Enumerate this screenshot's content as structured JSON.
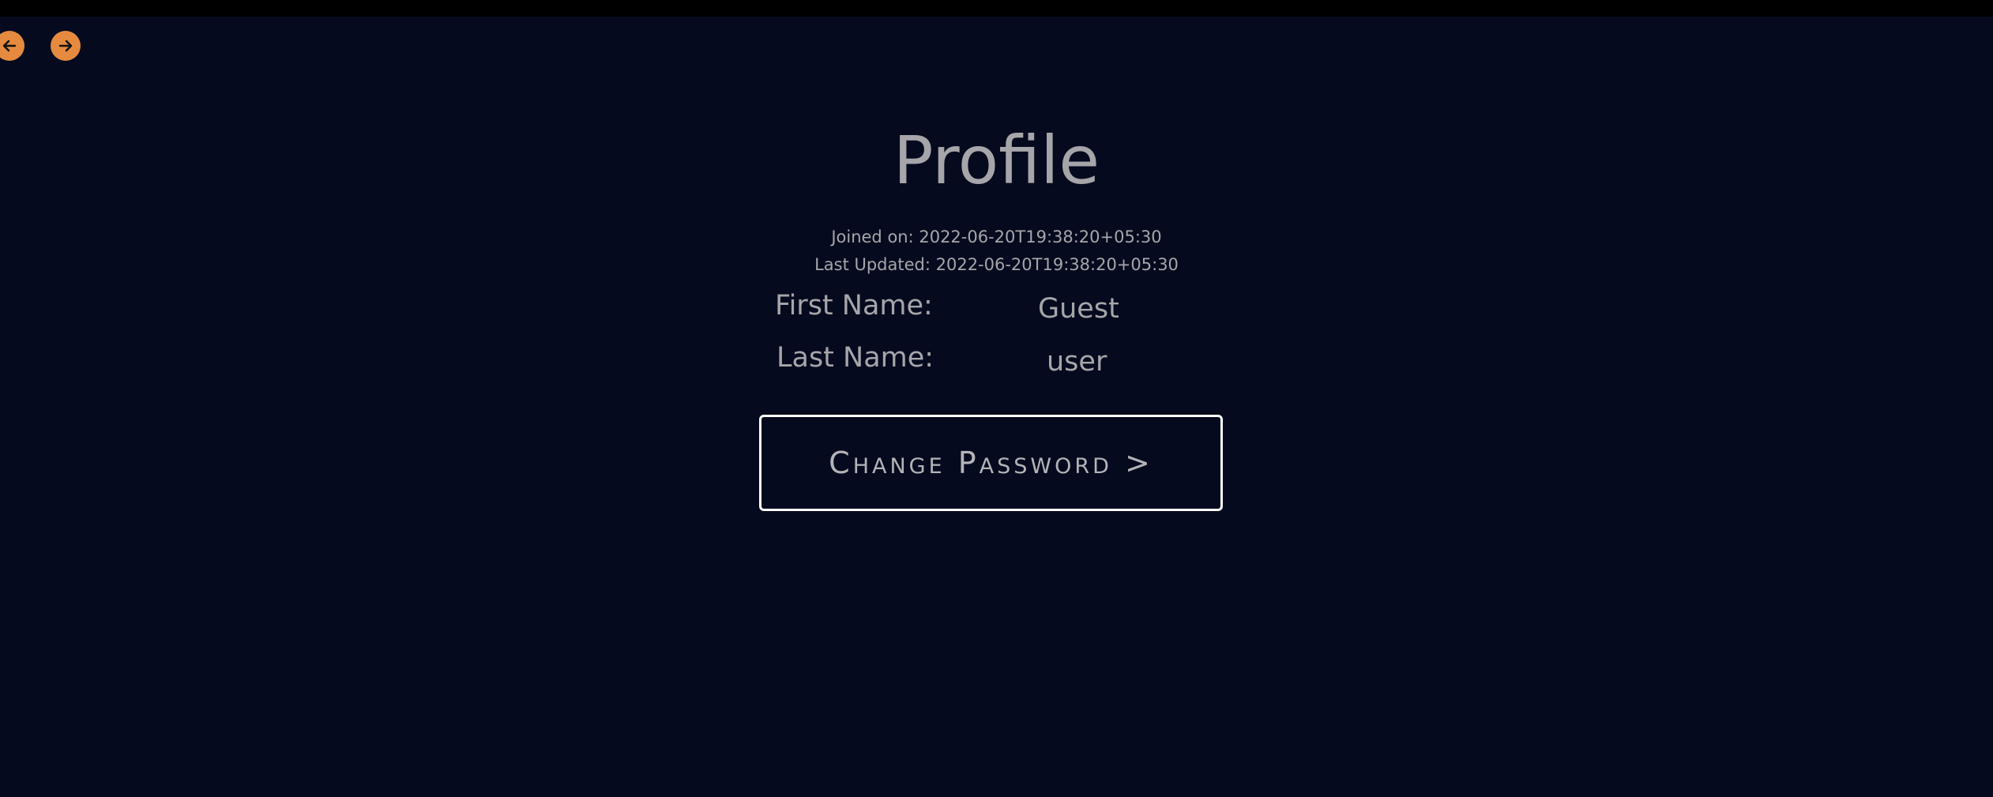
{
  "nav": {
    "back_icon": "arrow-left-icon",
    "forward_icon": "arrow-right-icon",
    "accent_color": "#e58a3f"
  },
  "profile": {
    "title": "Profile",
    "joined": "Joined on: 2022-06-20T19:38:20+05:30",
    "updated": "Last Updated: 2022-06-20T19:38:20+05:30",
    "first_name_label": "First Name:",
    "first_name_value": "Guest",
    "last_name_label": "Last Name:",
    "last_name_value": "user",
    "change_password_label": "Change Password >"
  },
  "colors": {
    "background": "#050a1e",
    "text": "#a6a6aa",
    "button_border": "#ffffff"
  }
}
